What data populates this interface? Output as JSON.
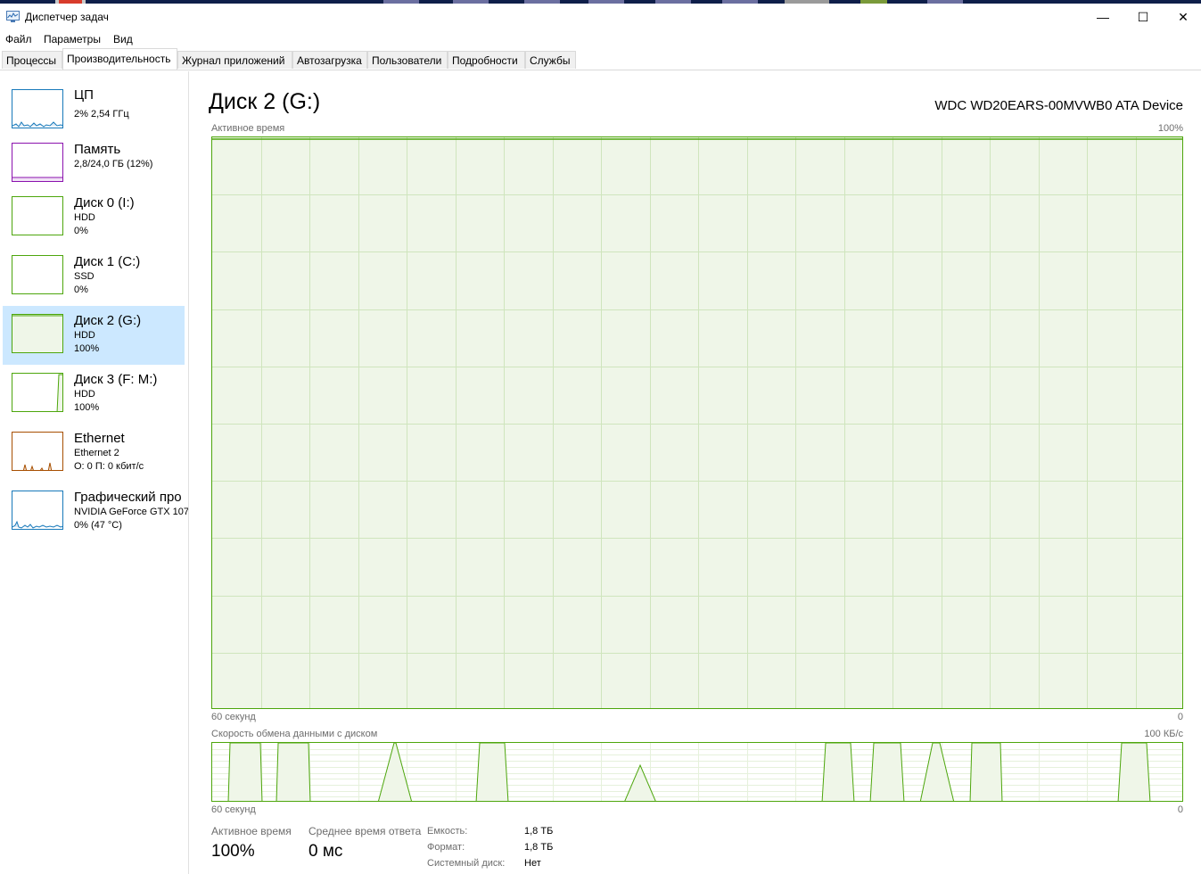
{
  "window": {
    "title": "Диспетчер задач",
    "minimize_glyph": "—",
    "maximize_glyph": "☐",
    "close_glyph": "✕"
  },
  "menu": [
    "Файл",
    "Параметры",
    "Вид"
  ],
  "tabs": [
    "Процессы",
    "Производительность",
    "Журнал приложений",
    "Автозагрузка",
    "Пользователи",
    "Подробности",
    "Службы"
  ],
  "active_tab": "Производительность",
  "sidebar": [
    {
      "title": "ЦП",
      "line1": "2% 2,54 ГГц",
      "line2": "",
      "color": "#1779ba",
      "kind": "cpu"
    },
    {
      "title": "Память",
      "line1": "2,8/24,0 ГБ (12%)",
      "line2": "",
      "color": "#8b12ae",
      "kind": "mem"
    },
    {
      "title": "Диск 0 (I:)",
      "line1": "HDD",
      "line2": "0%",
      "color": "#4da60c",
      "kind": "empty"
    },
    {
      "title": "Диск 1 (C:)",
      "line1": "SSD",
      "line2": "0%",
      "color": "#4da60c",
      "kind": "empty"
    },
    {
      "title": "Диск 2 (G:)",
      "line1": "HDD",
      "line2": "100%",
      "color": "#4da60c",
      "kind": "full",
      "selected": true
    },
    {
      "title": "Диск 3 (F: M:)",
      "line1": "HDD",
      "line2": "100%",
      "color": "#4da60c",
      "kind": "spike"
    },
    {
      "title": "Ethernet",
      "line1": "Ethernet 2",
      "line2": "О: 0 П: 0 кбит/с",
      "color": "#a74f01",
      "kind": "net"
    },
    {
      "title": "Графический про",
      "line1": "NVIDIA GeForce GTX 107",
      "line2": "0% (47 °C)",
      "color": "#1779ba",
      "kind": "gpu"
    }
  ],
  "main": {
    "title": "Диск 2 (G:)",
    "device": "WDC WD20EARS-00MVWB0 ATA Device",
    "graph1": {
      "label": "Активное время",
      "max_label": "100%",
      "x_left": "60 секунд",
      "x_right": "0",
      "active_time_percent": 100
    },
    "graph2": {
      "label": "Скорость обмена данными с диском",
      "max_label": "100 КБ/с",
      "x_left": "60 секунд",
      "x_right": "0"
    },
    "stats": {
      "active_time_label": "Активное время",
      "active_time_value": "100%",
      "response_label": "Среднее время ответа",
      "response_value": "0 мс"
    },
    "props": [
      {
        "label": "Емкость:",
        "value": "1,8 ТБ"
      },
      {
        "label": "Формат:",
        "value": "1,8 ТБ"
      },
      {
        "label": "Системный диск:",
        "value": "Нет"
      }
    ]
  },
  "colors": {
    "disk": "#4da60c",
    "disk_fill": "#eff6e8",
    "grid": "#cfe5bd",
    "selected_bg": "#cce8ff"
  }
}
